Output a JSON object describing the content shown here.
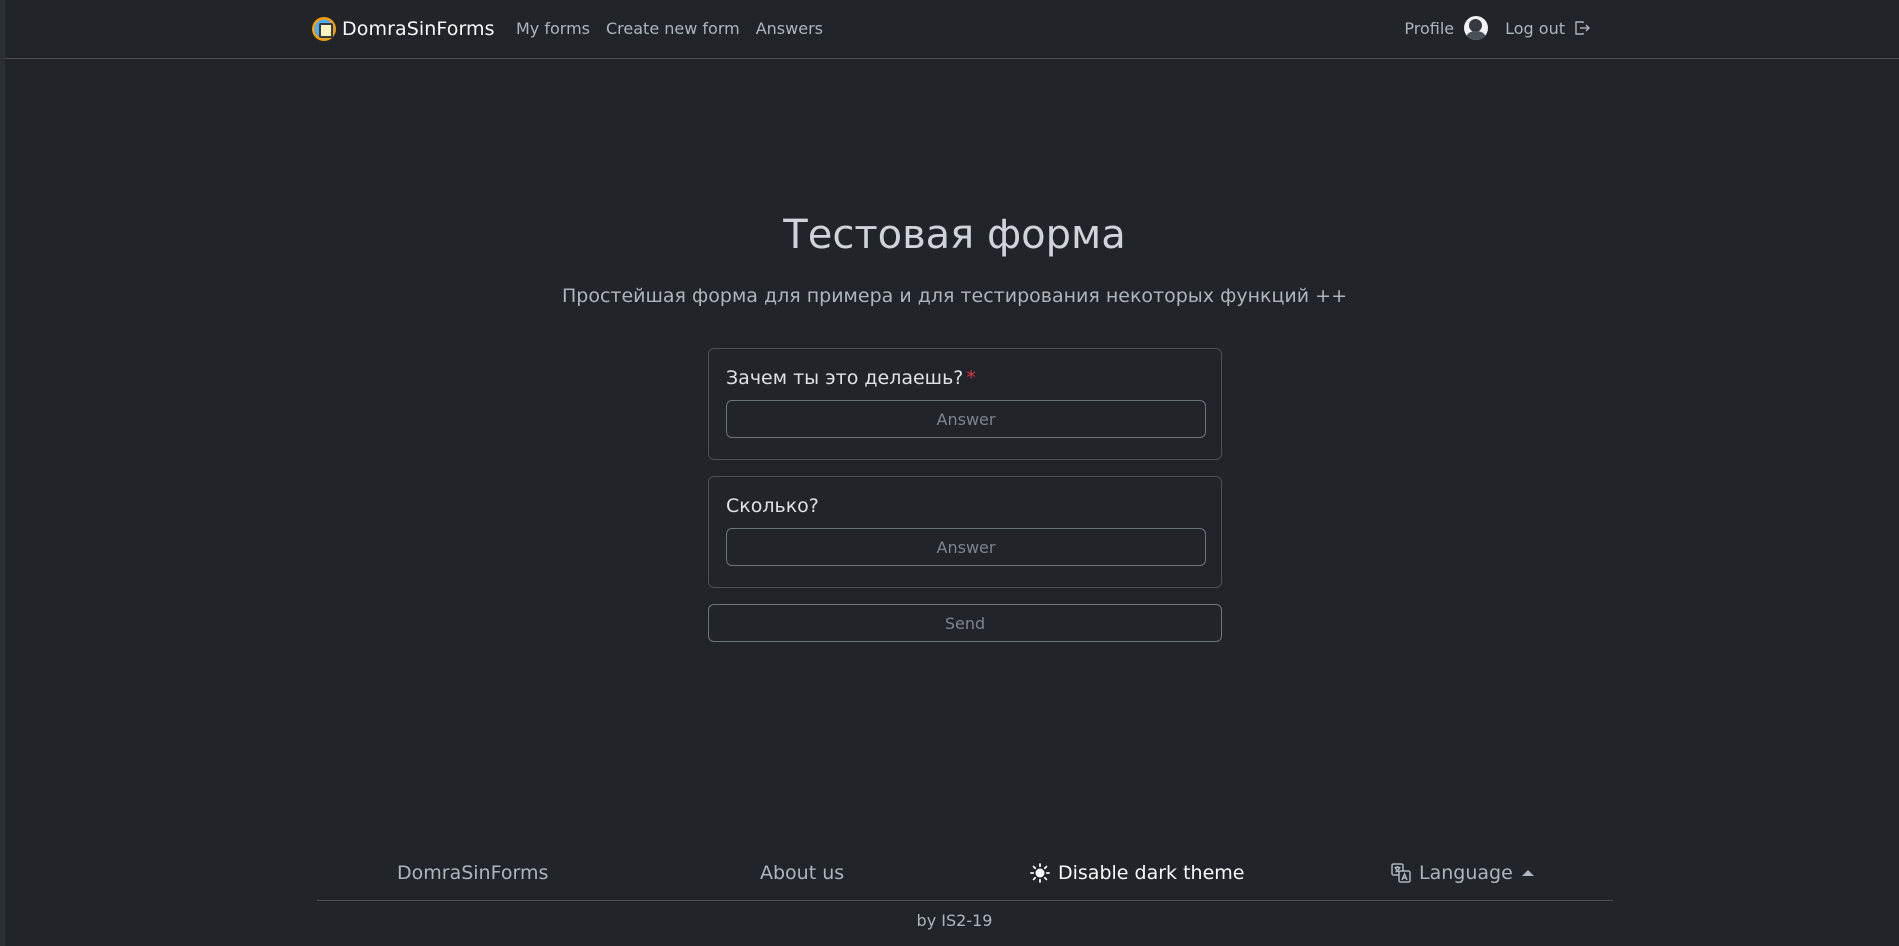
{
  "navbar": {
    "brand": "DomraSinForms",
    "links": [
      "My forms",
      "Create new form",
      "Answers"
    ],
    "profile": "Profile",
    "logout": "Log out"
  },
  "form": {
    "title": "Тестовая форма",
    "description": "Простейшая форма для примера и для тестирования некоторых функций ++",
    "questions": [
      {
        "label": "Зачем ты это делаешь?",
        "required_mark": "*",
        "placeholder": "Answer"
      },
      {
        "label": "Сколько?",
        "placeholder": "Answer"
      }
    ],
    "send": "Send"
  },
  "footer": {
    "brand": "DomraSinForms",
    "about": "About us",
    "theme": "Disable dark theme",
    "language": "Language",
    "byline": "by IS2-19"
  },
  "icons": {
    "logo": "domrasinforms-logo-icon",
    "avatar": "user-avatar",
    "logout": "box-arrow-right-icon",
    "theme": "sun-icon",
    "language": "translate-icon",
    "language_caret": "caret-up-icon"
  },
  "colors": {
    "background": "#212529",
    "border": "#495057",
    "required": "#dc3545"
  }
}
